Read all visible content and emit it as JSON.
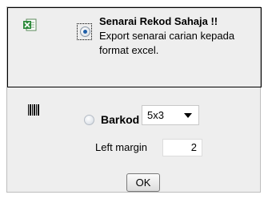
{
  "export": {
    "icon": "excel-icon",
    "title": "Senarai Rekod Sahaja !!",
    "description": "Export senarai carian kepada format excel.",
    "selected": true
  },
  "barkod": {
    "icon": "barcode-icon",
    "label": "Barkod",
    "selected": false,
    "size_value": "5x3",
    "margin_label": "Left margin",
    "margin_value": "2"
  },
  "ok_label": "OK",
  "colors": {
    "panel_bg": "#eeeeee",
    "excel_green": "#2e8b3c",
    "radio_dot": "#1f5fa8"
  }
}
